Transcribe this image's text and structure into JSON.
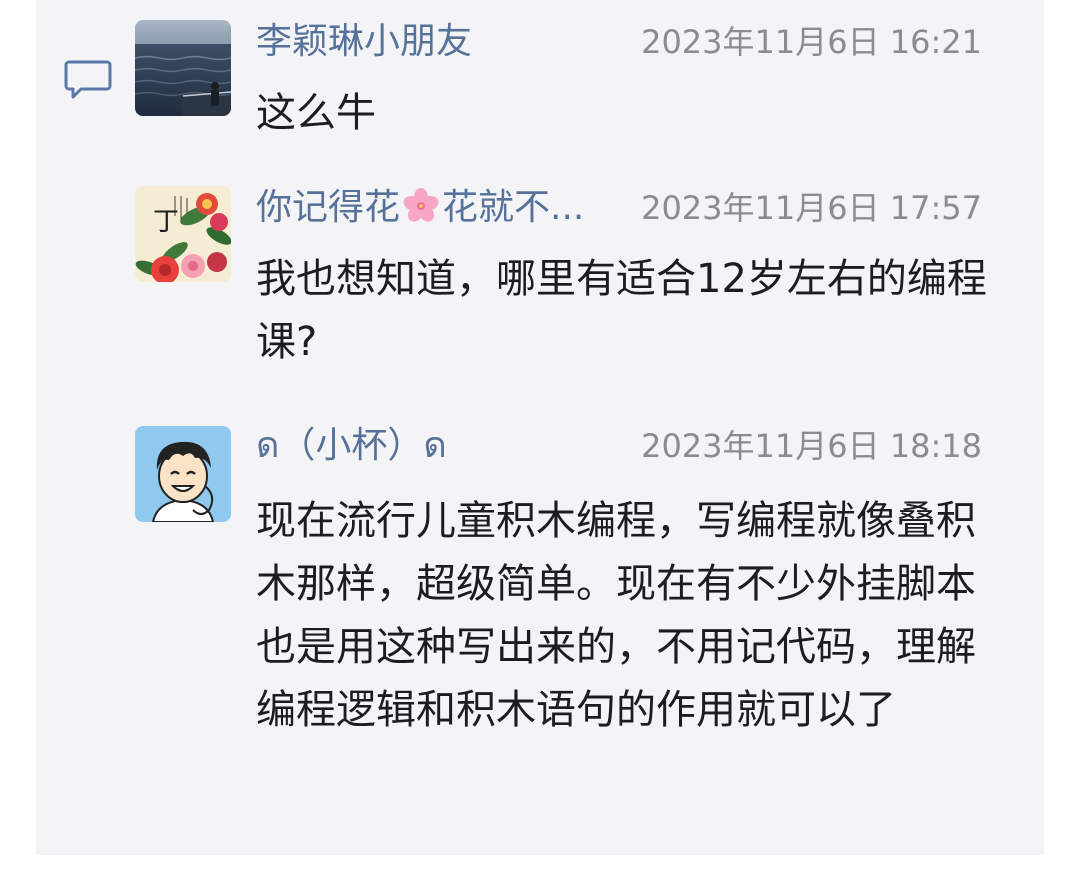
{
  "comments": [
    {
      "username": "李颖琳小朋友",
      "timestamp": "2023年11月6日 16:21",
      "content": "这么牛",
      "avatar": "sea-photo-avatar"
    },
    {
      "username_start": "你记得花",
      "username_emoji": "cherry-blossom-emoji",
      "username_end": "花就不...",
      "timestamp": "2023年11月6日 17:57",
      "content": "我也想知道，哪里有适合12岁左右的编程课?",
      "avatar": "peony-painting-avatar",
      "avatar_text": "丁"
    },
    {
      "username": "ด（小杯）ด",
      "timestamp": "2023年11月6日 18:18",
      "content": "现在流行儿童积木编程，写编程就像叠积木那样，超级简单。现在有不少外挂脚本也是用这种写出来的，不用记代码，理解编程逻辑和积木语句的作用就可以了",
      "avatar": "cartoon-boy-avatar"
    }
  ],
  "icons": {
    "reply": "comment-bubble-icon"
  },
  "colors": {
    "username": "#56719a",
    "timestamp": "#8c8c90",
    "content": "#1d1d1f",
    "panel": "#f4f4f6",
    "reply_icon": "#5a79a8"
  }
}
